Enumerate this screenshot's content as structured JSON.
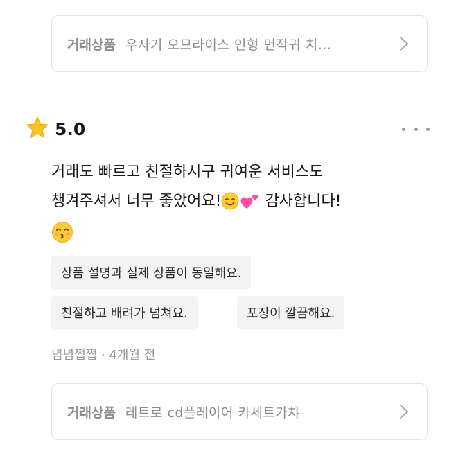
{
  "top_trade_card": {
    "label": "거래상품",
    "product_name": "우사기 오므라이스 인형 먼작귀 치...",
    "chevron_icon": "chevron-right-icon"
  },
  "review": {
    "rating_icon": "star-icon",
    "rating": "5.0",
    "more_icon": "more-horizontal-icon",
    "text_line1": "거래도 빠르고 친절하시구 귀여운 서비스도",
    "text_line2_a": "챙겨주셔서 너무 좋았어요!",
    "text_line2_b": " 감사합니다!",
    "emojis": [
      "smiling-face-with-smiling-eyes",
      "two-hearts",
      "kissing-face-with-smiling-eyes"
    ],
    "tags": [
      "상품 설명과 실제 상품이 동일해요.",
      "친절하고 배려가 넘쳐요.",
      "포장이 깔끔해요."
    ],
    "author": "념념쩝쩝",
    "separator": "·",
    "time_ago": "4개월 전"
  },
  "bottom_trade_card": {
    "label": "거래상품",
    "product_name": "레트로 cd플레이어 카세트가챠",
    "chevron_icon": "chevron-right-icon"
  },
  "colors": {
    "star": "#f7c325",
    "muted_text": "#8d8d8d",
    "card_border": "#e4e4e4",
    "tag_background": "#f3f3f3",
    "heart": "#ff4fa3"
  }
}
